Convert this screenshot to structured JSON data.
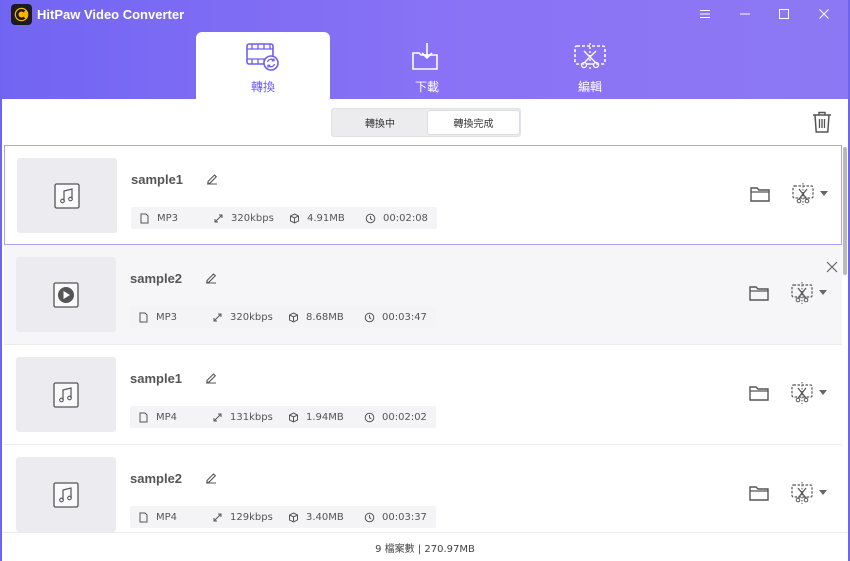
{
  "app": {
    "title": "HitPaw Video Converter",
    "accent_color": "#7a69f4",
    "icon": "hitpaw-logo-icon"
  },
  "window_controls": [
    "menu-icon",
    "minimize-icon",
    "maximize-icon",
    "close-icon"
  ],
  "nav_tabs": [
    {
      "label": "轉換",
      "icon": "convert-film-icon",
      "active": true
    },
    {
      "label": "下載",
      "icon": "download-folder-icon",
      "active": false
    },
    {
      "label": "編輯",
      "icon": "edit-cut-icon",
      "active": false
    }
  ],
  "subtabs": [
    {
      "label": "轉換中",
      "active": false
    },
    {
      "label": "轉換完成",
      "active": true
    }
  ],
  "toolbar": {
    "delete_icon": "trash-icon"
  },
  "files": [
    {
      "name": "sample1",
      "thumb_icon": "music-note-icon",
      "format": "MP3",
      "bitrate": "320kbps",
      "size": "4.91MB",
      "duration": "00:02:08",
      "state": "selected"
    },
    {
      "name": "sample2",
      "thumb_icon": "play-icon",
      "format": "MP3",
      "bitrate": "320kbps",
      "size": "8.68MB",
      "duration": "00:03:47",
      "state": "hover"
    },
    {
      "name": "sample1",
      "thumb_icon": "music-note-icon",
      "format": "MP4",
      "bitrate": "131kbps",
      "size": "1.94MB",
      "duration": "00:02:02",
      "state": "normal"
    },
    {
      "name": "sample2",
      "thumb_icon": "music-note-icon",
      "format": "MP4",
      "bitrate": "129kbps",
      "size": "3.40MB",
      "duration": "00:03:37",
      "state": "normal"
    }
  ],
  "status": {
    "summary": "9 檔案數 | 270.97MB"
  }
}
